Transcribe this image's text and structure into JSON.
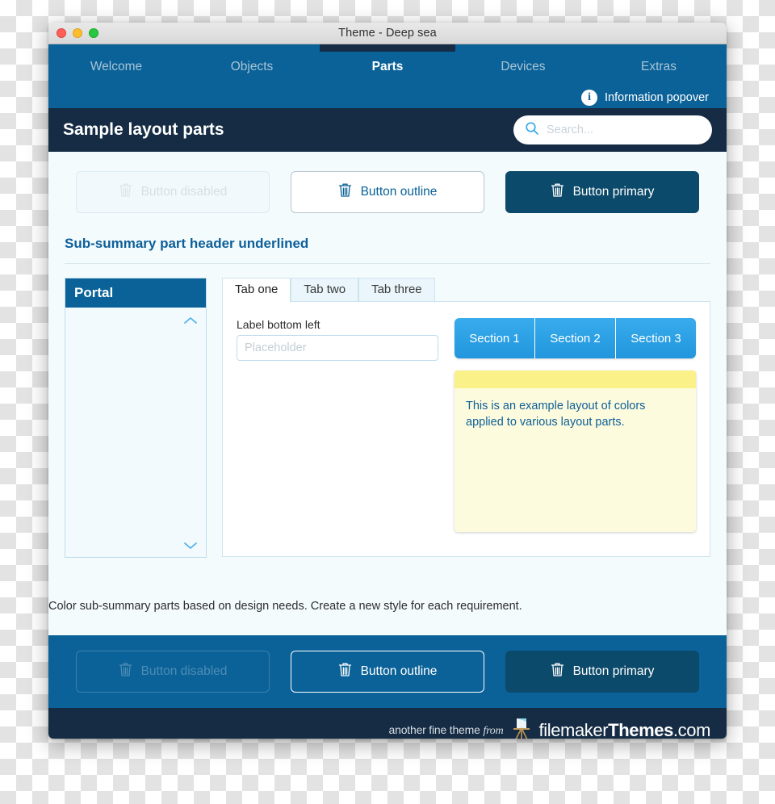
{
  "window": {
    "title": "Theme - Deep sea",
    "traffic_lights": [
      "close",
      "minimize",
      "zoom"
    ]
  },
  "nav": {
    "tabs": [
      {
        "label": "Welcome",
        "active": false
      },
      {
        "label": "Objects",
        "active": false
      },
      {
        "label": "Parts",
        "active": true
      },
      {
        "label": "Devices",
        "active": false
      },
      {
        "label": "Extras",
        "active": false
      }
    ],
    "popover_label": "Information popover",
    "popover_icon": "info-circle-icon"
  },
  "header": {
    "title": "Sample layout parts",
    "search": {
      "placeholder": "Search...",
      "value": "",
      "icon": "search-icon"
    }
  },
  "top_buttons": [
    {
      "label": "Button disabled",
      "state": "disabled",
      "icon": "trash-icon"
    },
    {
      "label": "Button outline",
      "state": "outline",
      "icon": "trash-icon"
    },
    {
      "label": "Button primary",
      "state": "primary",
      "icon": "trash-icon"
    }
  ],
  "sub_summary": {
    "title": "Sub-summary part header underlined"
  },
  "portal": {
    "title": "Portal",
    "scroll_up_icon": "chevron-up-icon",
    "scroll_down_icon": "chevron-down-icon"
  },
  "tabs": {
    "items": [
      {
        "label": "Tab one",
        "active": true
      },
      {
        "label": "Tab two",
        "active": false
      },
      {
        "label": "Tab three",
        "active": false
      }
    ],
    "field": {
      "label": "Label bottom left",
      "placeholder": "Placeholder",
      "value": ""
    },
    "segmented": [
      {
        "label": "Section 1"
      },
      {
        "label": "Section 2"
      },
      {
        "label": "Section 3"
      }
    ],
    "note": {
      "text": "This is an example layout of colors applied to various layout parts."
    }
  },
  "caption": {
    "text": "Color sub-summary parts based on design needs. Create a new style for each requirement."
  },
  "bottom_buttons": [
    {
      "label": "Button disabled",
      "state": "disabled",
      "icon": "trash-icon"
    },
    {
      "label": "Button outline",
      "state": "outline",
      "icon": "trash-icon"
    },
    {
      "label": "Button primary",
      "state": "primary",
      "icon": "trash-icon"
    }
  ],
  "footer": {
    "prefix": "another fine theme ",
    "prefix_italic": "from",
    "brand_light": "filemaker",
    "brand_bold": "Themes",
    "brand_tld": ".com",
    "easel_icon": "easel-icon"
  },
  "colors": {
    "nav_blue": "#0a6298",
    "dark_navy": "#152c44",
    "primary_button": "#0c4a6b",
    "accent_link": "#0c5f99",
    "segment_blue": "#2196dd",
    "note_yellow": "#fdfbdd",
    "note_top_yellow": "#faf189",
    "body_bg": "#f4fbfd"
  }
}
